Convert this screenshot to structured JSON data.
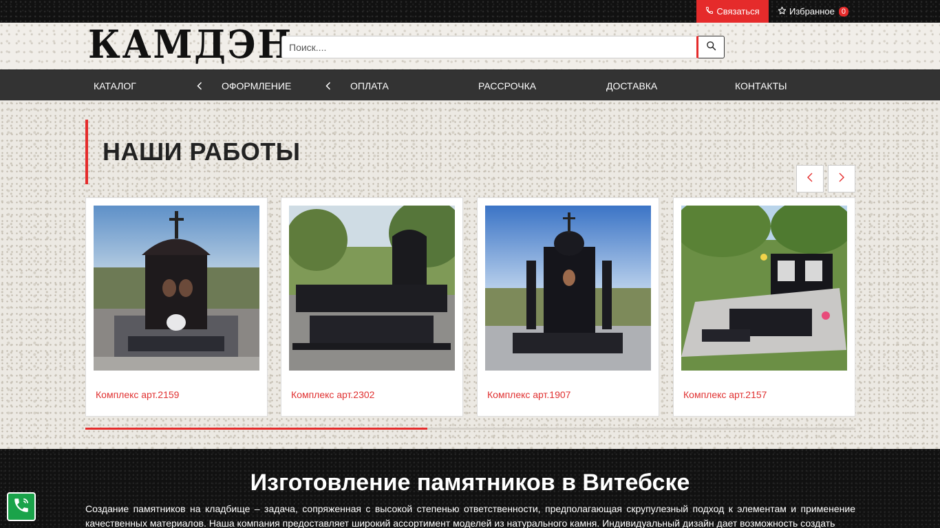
{
  "topbar": {
    "contact_label": "Связаться",
    "favorites_label": "Избранное",
    "favorites_count": "0",
    "accent": "#e52b2b"
  },
  "header": {
    "logo_text": "КАМДЭН",
    "search_placeholder": "Поиск....",
    "search_value": ""
  },
  "nav": {
    "items": [
      "КАТАЛОГ",
      "ОФОРМЛЕНИЕ",
      "ОПЛАТА",
      "РАССРОЧКА",
      "ДОСТАВКА",
      "КОНТАКТЫ"
    ]
  },
  "works": {
    "title": "НАШИ РАБОТЫ",
    "cards": [
      {
        "title": "Комплекс арт.2159"
      },
      {
        "title": "Комплекс арт.2302"
      },
      {
        "title": "Комплекс арт.1907"
      },
      {
        "title": "Комплекс арт.2157"
      }
    ],
    "slider_progress": 0.444
  },
  "about": {
    "title": "Изготовление памятников в Витебске",
    "text": "Создание памятников на кладбище – задача, сопряженная с высокой степенью ответственности, предполагающая скрупулезный подход к элементам и применение качественных материалов. Наша компания предоставляет широкий ассортимент моделей из натурального камня. Индивидуальный дизайн дает возможность создать"
  },
  "icons": {
    "phone": "phone-icon",
    "star": "star-icon",
    "search": "search-icon",
    "chevron_left": "chevron-left-icon",
    "chevron_right": "chevron-right-icon"
  }
}
